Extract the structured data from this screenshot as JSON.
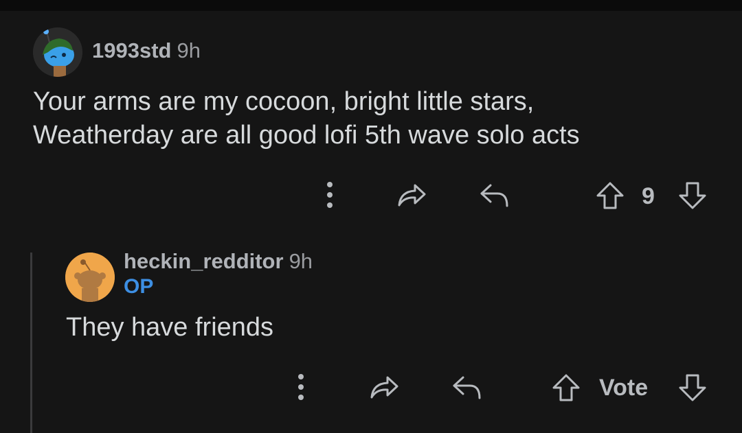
{
  "comments": [
    {
      "username": "1993std",
      "time": "9h",
      "body_lines": [
        "Your arms are my cocoon, bright little stars,",
        "Weatherday are all good lofi 5th wave solo acts"
      ],
      "score": "9",
      "avatar_icon": "snoo-avatar-green-hat-icon"
    },
    {
      "username": "heckin_redditor",
      "time": "9h",
      "flair": "OP",
      "body_lines": [
        "They have friends"
      ],
      "score": "Vote",
      "avatar_icon": "snoo-avatar-default-icon"
    }
  ],
  "icons": {
    "more": "more-vertical-icon",
    "share": "share-icon",
    "reply": "reply-icon",
    "upvote": "upvote-arrow-icon",
    "downvote": "downvote-arrow-icon"
  },
  "colors": {
    "background": "#151515",
    "text": "#d7dadc",
    "muted": "#b0b3b8",
    "op_flair": "#3d8fe3"
  }
}
